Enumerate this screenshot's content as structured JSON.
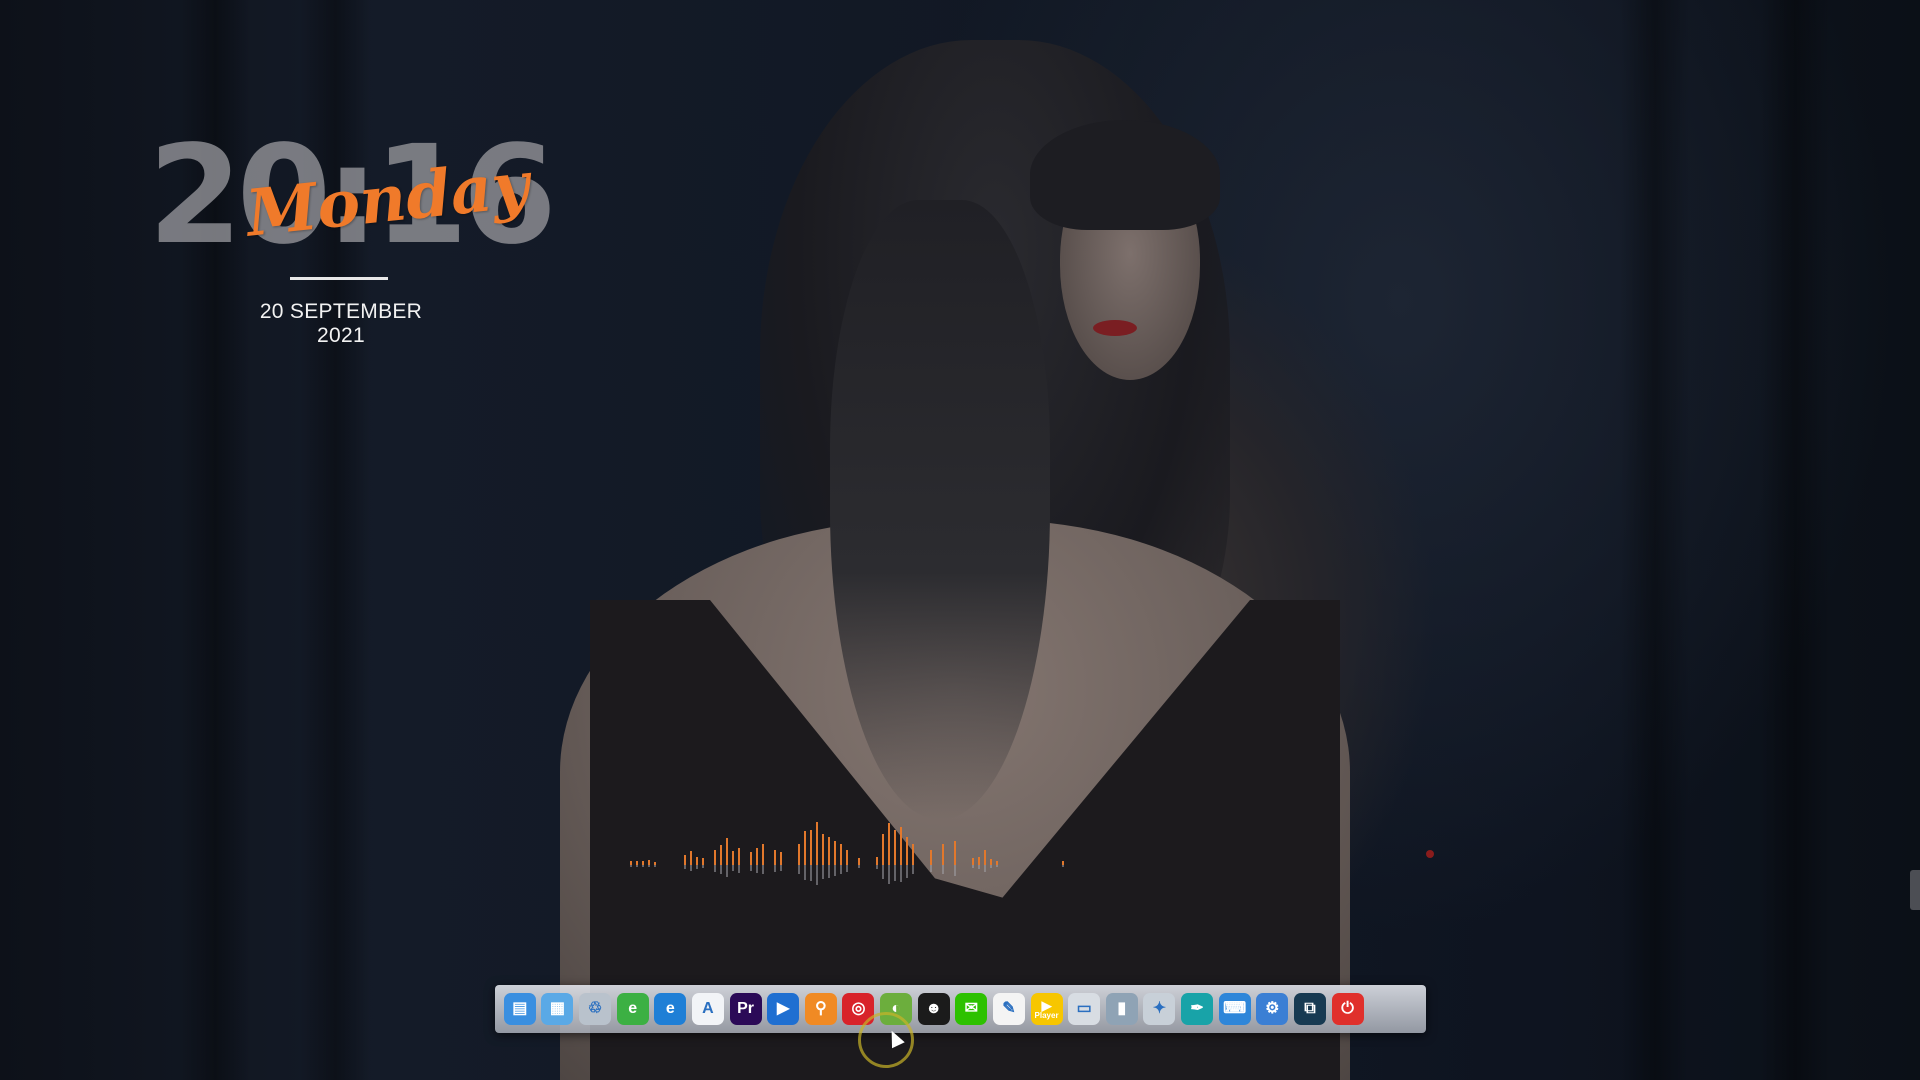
{
  "clock": {
    "time": "20:16",
    "day": "Monday",
    "date": "20 SEPTEMBER 2021"
  },
  "visualizer": {
    "color": "#e2782c",
    "levels": [
      0.06,
      0.06,
      0.06,
      0.07,
      0.05,
      0,
      0,
      0,
      0,
      0.14,
      0.2,
      0.12,
      0.1,
      0,
      0.22,
      0.28,
      0.38,
      0.2,
      0.25,
      0,
      0.18,
      0.24,
      0.3,
      0,
      0.22,
      0.18,
      0,
      0,
      0.3,
      0.48,
      0.5,
      0.62,
      0.45,
      0.4,
      0.35,
      0.3,
      0.22,
      0,
      0.1,
      0,
      0,
      0.12,
      0.45,
      0.6,
      0.5,
      0.55,
      0.4,
      0.3,
      0,
      0,
      0.22,
      0,
      0.3,
      0,
      0.35,
      0,
      0,
      0.1,
      0.12,
      0.22,
      0.08,
      0.06,
      0,
      0,
      0,
      0,
      0,
      0,
      0,
      0,
      0,
      0,
      0.06
    ]
  },
  "dock": {
    "items": [
      {
        "name": "finder-icon",
        "glyph": "▤",
        "bg": "#3a8fe0"
      },
      {
        "name": "control-panel-icon",
        "glyph": "▦",
        "bg": "#5aa9e6"
      },
      {
        "name": "recycle-bin-icon",
        "glyph": "♲",
        "bg": "#b9c2cc"
      },
      {
        "name": "ie-browser-icon",
        "glyph": "e",
        "bg": "#3cb043"
      },
      {
        "name": "edge-browser-icon",
        "glyph": "e",
        "bg": "#1f7fd6"
      },
      {
        "name": "app-store-icon",
        "glyph": "A",
        "bg": "#f2f4f7"
      },
      {
        "name": "premiere-pro-icon",
        "glyph": "Pr",
        "bg": "#2b0a57"
      },
      {
        "name": "video-recorder-icon",
        "glyph": "▶",
        "bg": "#1f6fd1"
      },
      {
        "name": "search-icon",
        "glyph": "⚲",
        "bg": "#f08a24"
      },
      {
        "name": "netease-music-icon",
        "glyph": "◎",
        "bg": "#d8232a"
      },
      {
        "name": "globe-app-icon",
        "glyph": "◐",
        "bg": "#6cae3d"
      },
      {
        "name": "qq-penguin-icon",
        "glyph": "☻",
        "bg": "#1b1b1b"
      },
      {
        "name": "wechat-icon",
        "glyph": "✉",
        "bg": "#2dc100"
      },
      {
        "name": "color-picker-icon",
        "glyph": "✎",
        "bg": "#f4f4f4"
      },
      {
        "name": "potplayer-icon",
        "glyph": "▶",
        "label": "Player",
        "bg": "#f7c600"
      },
      {
        "name": "monitor-icon",
        "glyph": "▭",
        "bg": "#d8dde3"
      },
      {
        "name": "trash-can-icon",
        "glyph": "▮",
        "bg": "#8fa3b5"
      },
      {
        "name": "photo-robot-icon",
        "glyph": "✦",
        "bg": "#c8d0d8"
      },
      {
        "name": "pen-tool-icon",
        "glyph": "✒",
        "bg": "#18a3a8"
      },
      {
        "name": "keyboard-icon",
        "glyph": "⌨",
        "bg": "#2e86d9"
      },
      {
        "name": "network-settings-icon",
        "glyph": "⚙",
        "bg": "#3b7fd4"
      },
      {
        "name": "virtual-desktop-icon",
        "glyph": "⧉",
        "bg": "#173a52"
      },
      {
        "name": "power-icon",
        "glyph": "⏻",
        "bg": "#e0302b"
      }
    ]
  }
}
